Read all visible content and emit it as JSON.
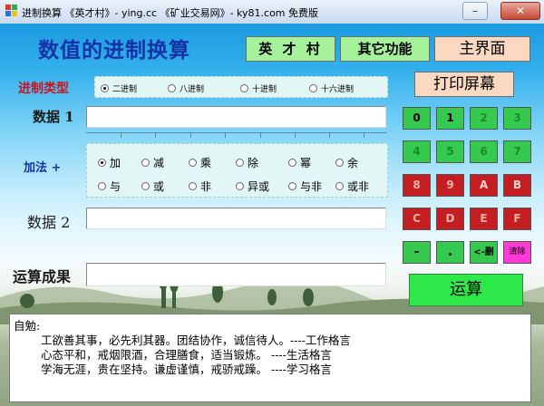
{
  "window": {
    "title": "进制换算   《英才村》- ying.cc   《矿业交易网》- ky81.com    免费版",
    "min_label": "–",
    "max_label": "▢",
    "close_label": "✕"
  },
  "app": {
    "main_title": "数值的进制换算",
    "btn_yingcai": "英 才 村",
    "btn_other": "其它功能",
    "btn_home": "主界面",
    "btn_print": "打印屏幕"
  },
  "base_type": {
    "label": "进制类型",
    "options": [
      "二进制",
      "八进制",
      "十进制",
      "十六进制"
    ],
    "selected": "二进制"
  },
  "data1": {
    "label": "数据 1",
    "value": ""
  },
  "data2": {
    "label": "数据 2",
    "value": ""
  },
  "result": {
    "label": "运算成果",
    "value": ""
  },
  "operation": {
    "label": "加法 +",
    "row1": [
      "加",
      "减",
      "乘",
      "除",
      "幂",
      "余"
    ],
    "row2": [
      "与",
      "或",
      "非",
      "异或",
      "与非",
      "或非"
    ],
    "selected": "加"
  },
  "keypad": {
    "rows": [
      [
        "0",
        "1",
        "2",
        "3"
      ],
      [
        "4",
        "5",
        "6",
        "7"
      ],
      [
        "8",
        "9",
        "A",
        "B"
      ],
      [
        "C",
        "D",
        "E",
        "F"
      ]
    ],
    "minus": "-",
    "dot": ".",
    "backspace": "<-删",
    "clear": "清除"
  },
  "compute_button": "运算",
  "motto": {
    "heading": "自勉:",
    "lines": [
      "工欲善其事，必先利其器。团结协作，诚信待人。----工作格言",
      "心态平和，戒烟限酒，合理膳食，适当锻炼。    ----生活格言",
      "学海无涯，贵在坚持。谦虚谨慎，戒骄戒躁。    ----学习格言"
    ]
  },
  "colors": {
    "title_blue": "#1533a6",
    "label_red": "#c8141e",
    "label_dark": "#1a1a1a",
    "key_green": "#35c94f",
    "key_red": "#c41e23",
    "key_pink": "#ff39d6",
    "compute_green": "#2fe84a"
  }
}
